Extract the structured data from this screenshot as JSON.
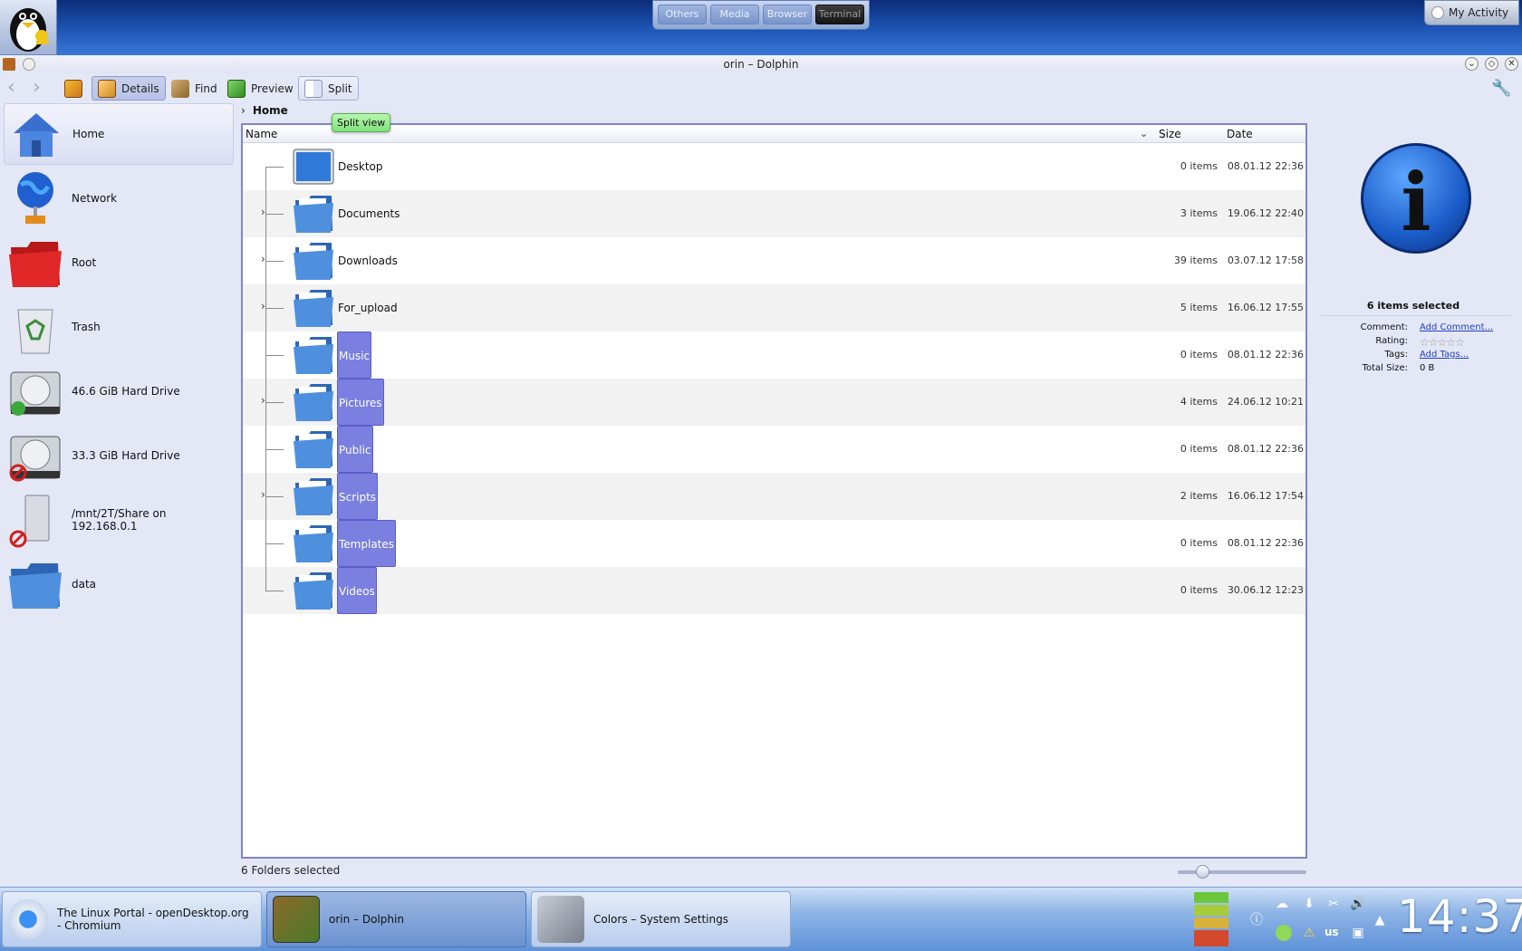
{
  "desktop": {
    "pager": [
      "Others",
      "Media",
      "Browser",
      "Terminal"
    ],
    "activity_label": "My Activity"
  },
  "window": {
    "title": "orin – Dolphin"
  },
  "toolbar": {
    "details_label": "Details",
    "find_label": "Find",
    "preview_label": "Preview",
    "split_label": "Split",
    "split_tooltip": "Split view"
  },
  "places": [
    {
      "label": "Home",
      "icon": "home-icon"
    },
    {
      "label": "Network",
      "icon": "network-icon"
    },
    {
      "label": "Root",
      "icon": "root-folder-icon"
    },
    {
      "label": "Trash",
      "icon": "trash-icon"
    },
    {
      "label": "46.6 GiB Hard Drive",
      "icon": "hard-drive-icon"
    },
    {
      "label": "33.3 GiB Hard Drive",
      "icon": "hard-drive-unmounted-icon"
    },
    {
      "label": "/mnt/2T/Share on 192.168.0.1",
      "icon": "network-share-icon"
    },
    {
      "label": "data",
      "icon": "folder-icon"
    }
  ],
  "breadcrumb": "Home",
  "columns": {
    "name": "Name",
    "size": "Size",
    "date": "Date"
  },
  "files": [
    {
      "name": "Desktop",
      "size": "0 items",
      "date": "08.01.12 22:36",
      "expandable": false,
      "selected": false,
      "icon": "desktop-icon"
    },
    {
      "name": "Documents",
      "size": "3 items",
      "date": "19.06.12 22:40",
      "expandable": true,
      "selected": false,
      "icon": "folder-icon"
    },
    {
      "name": "Downloads",
      "size": "39 items",
      "date": "03.07.12 17:58",
      "expandable": true,
      "selected": false,
      "icon": "folder-icon"
    },
    {
      "name": "For_upload",
      "size": "5 items",
      "date": "16.06.12 17:55",
      "expandable": true,
      "selected": false,
      "icon": "folder-icon"
    },
    {
      "name": "Music",
      "size": "0 items",
      "date": "08.01.12 22:36",
      "expandable": false,
      "selected": true,
      "icon": "folder-icon"
    },
    {
      "name": "Pictures",
      "size": "4 items",
      "date": "24.06.12 10:21",
      "expandable": true,
      "selected": true,
      "icon": "folder-icon"
    },
    {
      "name": "Public",
      "size": "0 items",
      "date": "08.01.12 22:36",
      "expandable": false,
      "selected": true,
      "icon": "folder-icon"
    },
    {
      "name": "Scripts",
      "size": "2 items",
      "date": "16.06.12 17:54",
      "expandable": true,
      "selected": true,
      "icon": "folder-icon"
    },
    {
      "name": "Templates",
      "size": "0 items",
      "date": "08.01.12 22:36",
      "expandable": false,
      "selected": true,
      "icon": "folder-icon"
    },
    {
      "name": "Videos",
      "size": "0 items",
      "date": "30.06.12 12:23",
      "expandable": false,
      "selected": true,
      "icon": "folder-icon"
    }
  ],
  "status": "6 Folders selected",
  "info": {
    "selected": "6 items selected",
    "comment_label": "Comment:",
    "comment_value": "Add Comment...",
    "rating_label": "Rating:",
    "rating_value": 0,
    "tags_label": "Tags:",
    "tags_value": "Add Tags...",
    "total_label": "Total Size:",
    "total_value": "0 B"
  },
  "taskbar": {
    "tasks": [
      {
        "label": "The Linux Portal - openDesktop.org - Chromium",
        "icon": "chromium-icon"
      },
      {
        "label": "orin – Dolphin",
        "icon": "dolphin-icon"
      },
      {
        "label": "Colors – System Settings",
        "icon": "system-settings-icon"
      }
    ],
    "keyboard_layout": "us",
    "clock": "14:37"
  },
  "colors": {
    "selection": "#7a7fe0",
    "panel_bg": "#e4e7f6",
    "view_border": "#7f85c8",
    "tooltip": "#8fe88a"
  }
}
